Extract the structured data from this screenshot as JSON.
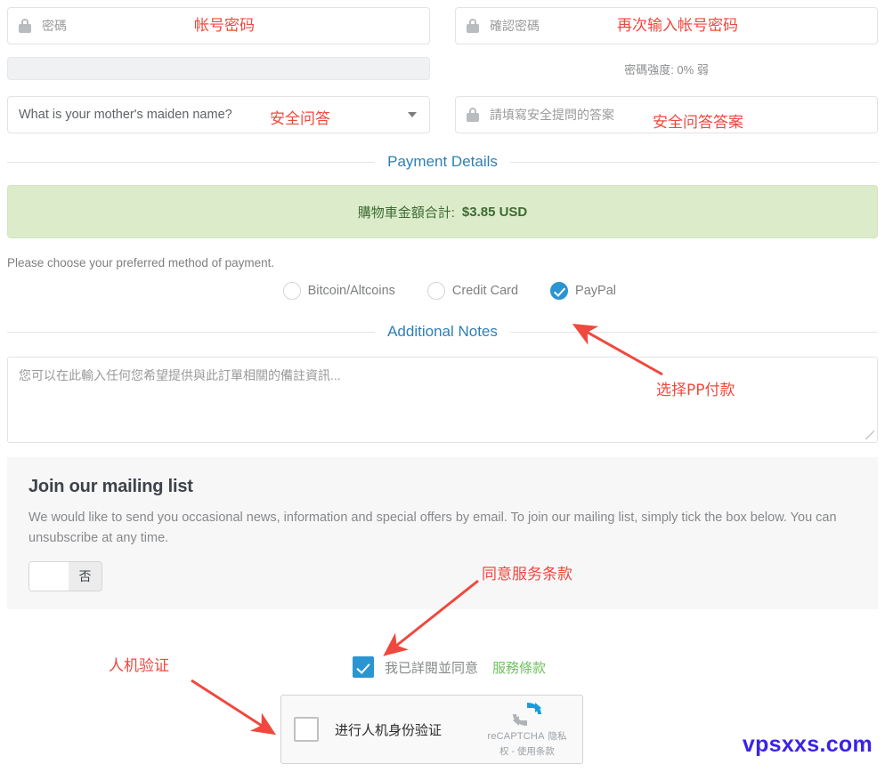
{
  "form": {
    "password_field": {
      "placeholder": "密碼",
      "icon": "lock-icon"
    },
    "confirm_password_field": {
      "placeholder": "確認密碼",
      "icon": "lock-icon"
    },
    "password_strength": "密碼強度: 0% 弱",
    "security_question": {
      "selected": "What is your mother's maiden name?",
      "caret_icon": "chevron-down-icon"
    },
    "security_answer_field": {
      "placeholder": "請填寫安全提問的答案",
      "icon": "lock-icon"
    }
  },
  "payment": {
    "legend": "Payment Details",
    "cart_label": "購物車金額合計:",
    "cart_amount": "$3.85 USD",
    "hint": "Please choose your preferred method of payment.",
    "methods": [
      {
        "label": "Bitcoin/Altcoins",
        "checked": false
      },
      {
        "label": "Credit Card",
        "checked": false
      },
      {
        "label": "PayPal",
        "checked": true
      }
    ]
  },
  "notes": {
    "legend": "Additional Notes",
    "placeholder": "您可以在此輸入任何您希望提供與此訂單相關的備註資訊..."
  },
  "mailing": {
    "title": "Join our mailing list",
    "description": "We would like to send you occasional news, information and special offers by email. To join our mailing list, simply tick the box below. You can unsubscribe at any time.",
    "toggle_state": "否"
  },
  "terms": {
    "text": "我已詳閱並同意",
    "link": "服務條款",
    "checked": true
  },
  "recaptcha": {
    "label": "进行人机身份验证",
    "brand": "reCAPTCHA",
    "links": "隐私权 - 使用条款",
    "logo_icon": "recaptcha-icon"
  },
  "annotations": [
    {
      "text": "帐号密码"
    },
    {
      "text": "再次输入帐号密码"
    },
    {
      "text": "安全问答"
    },
    {
      "text": "安全问答答案"
    },
    {
      "text": "选择PP付款"
    },
    {
      "text": "同意服务条款"
    },
    {
      "text": "人机验证"
    }
  ],
  "watermark": "vpsxxs.com",
  "colors": {
    "accent_blue": "#2b95d1",
    "legend_blue": "#2f7fb5",
    "banner_green_bg": "#dceccb",
    "banner_green_text": "#3d6a34",
    "link_green": "#6fbf5e",
    "annotation_red": "#f0483e",
    "watermark_blue": "#3a23e8"
  }
}
